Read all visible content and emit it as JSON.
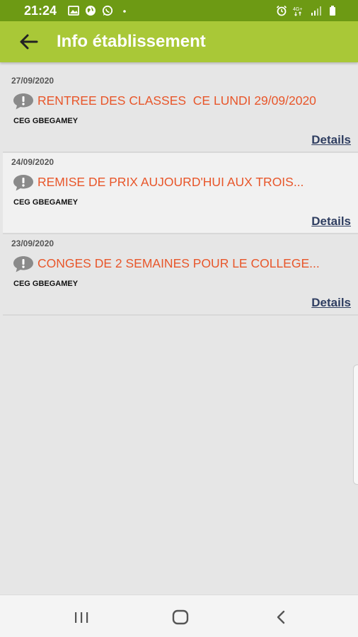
{
  "status_bar": {
    "time": "21:24",
    "background": "#6d9a14",
    "icons": [
      "image-icon",
      "globe-icon",
      "whatsapp-icon",
      "dot-icon",
      "alarm-icon",
      "network-4g-icon",
      "signal-icon",
      "battery-icon"
    ]
  },
  "app_bar": {
    "title": "Info établissement",
    "background": "#a9c837"
  },
  "notices": [
    {
      "date": "27/09/2020",
      "title": "RENTREE DES CLASSES  CE LUNDI 29/09/2020",
      "school": "CEG GBEGAMEY",
      "details": "Details"
    },
    {
      "date": "24/09/2020",
      "title": "REMISE DE PRIX AUJOURD'HUI AUX TROIS...",
      "school": "CEG GBEGAMEY",
      "details": "Details"
    },
    {
      "date": "23/09/2020",
      "title": "CONGES DE 2 SEMAINES POUR LE COLLEGE...",
      "school": "CEG GBEGAMEY",
      "details": "Details"
    }
  ],
  "colors": {
    "title_text": "#e8562a",
    "details_link": "#2f3e61"
  },
  "nav_bar": {
    "icons": [
      "recent-apps-icon",
      "home-icon",
      "back-icon"
    ]
  }
}
